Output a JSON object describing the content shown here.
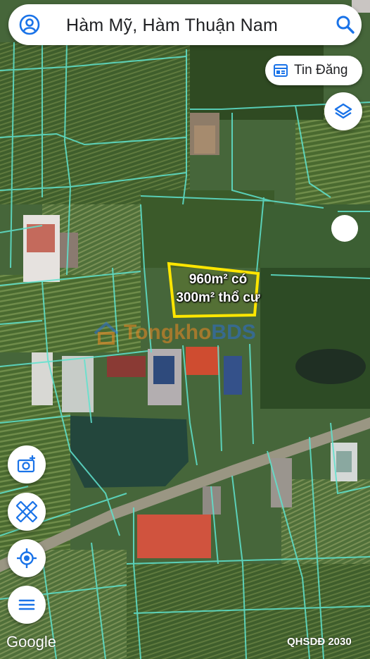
{
  "search": {
    "title": "Hàm Mỹ, Hàm Thuận Nam"
  },
  "listing_button": {
    "label": "Tin Đăng"
  },
  "parcel": {
    "area_line": "960m² có",
    "residential_line": "300m² thổ cư"
  },
  "watermark": {
    "text_orange": "Tongkho",
    "text_blue": "BDS"
  },
  "attribution": {
    "logo": "Google",
    "plan": "QHSDĐ 2030"
  },
  "icons": {
    "avatar": "account-circle-icon",
    "search": "search-icon",
    "listing": "calendar-listing-icon",
    "layers": "layers-icon",
    "camera": "add-photo-icon",
    "measure": "ruler-icon",
    "location": "my-location-icon",
    "menu": "menu-icon"
  },
  "colors": {
    "accent": "#1a73e8",
    "parcel_highlight": "#ffe600",
    "boundary_lines": "#5fe3cf"
  }
}
